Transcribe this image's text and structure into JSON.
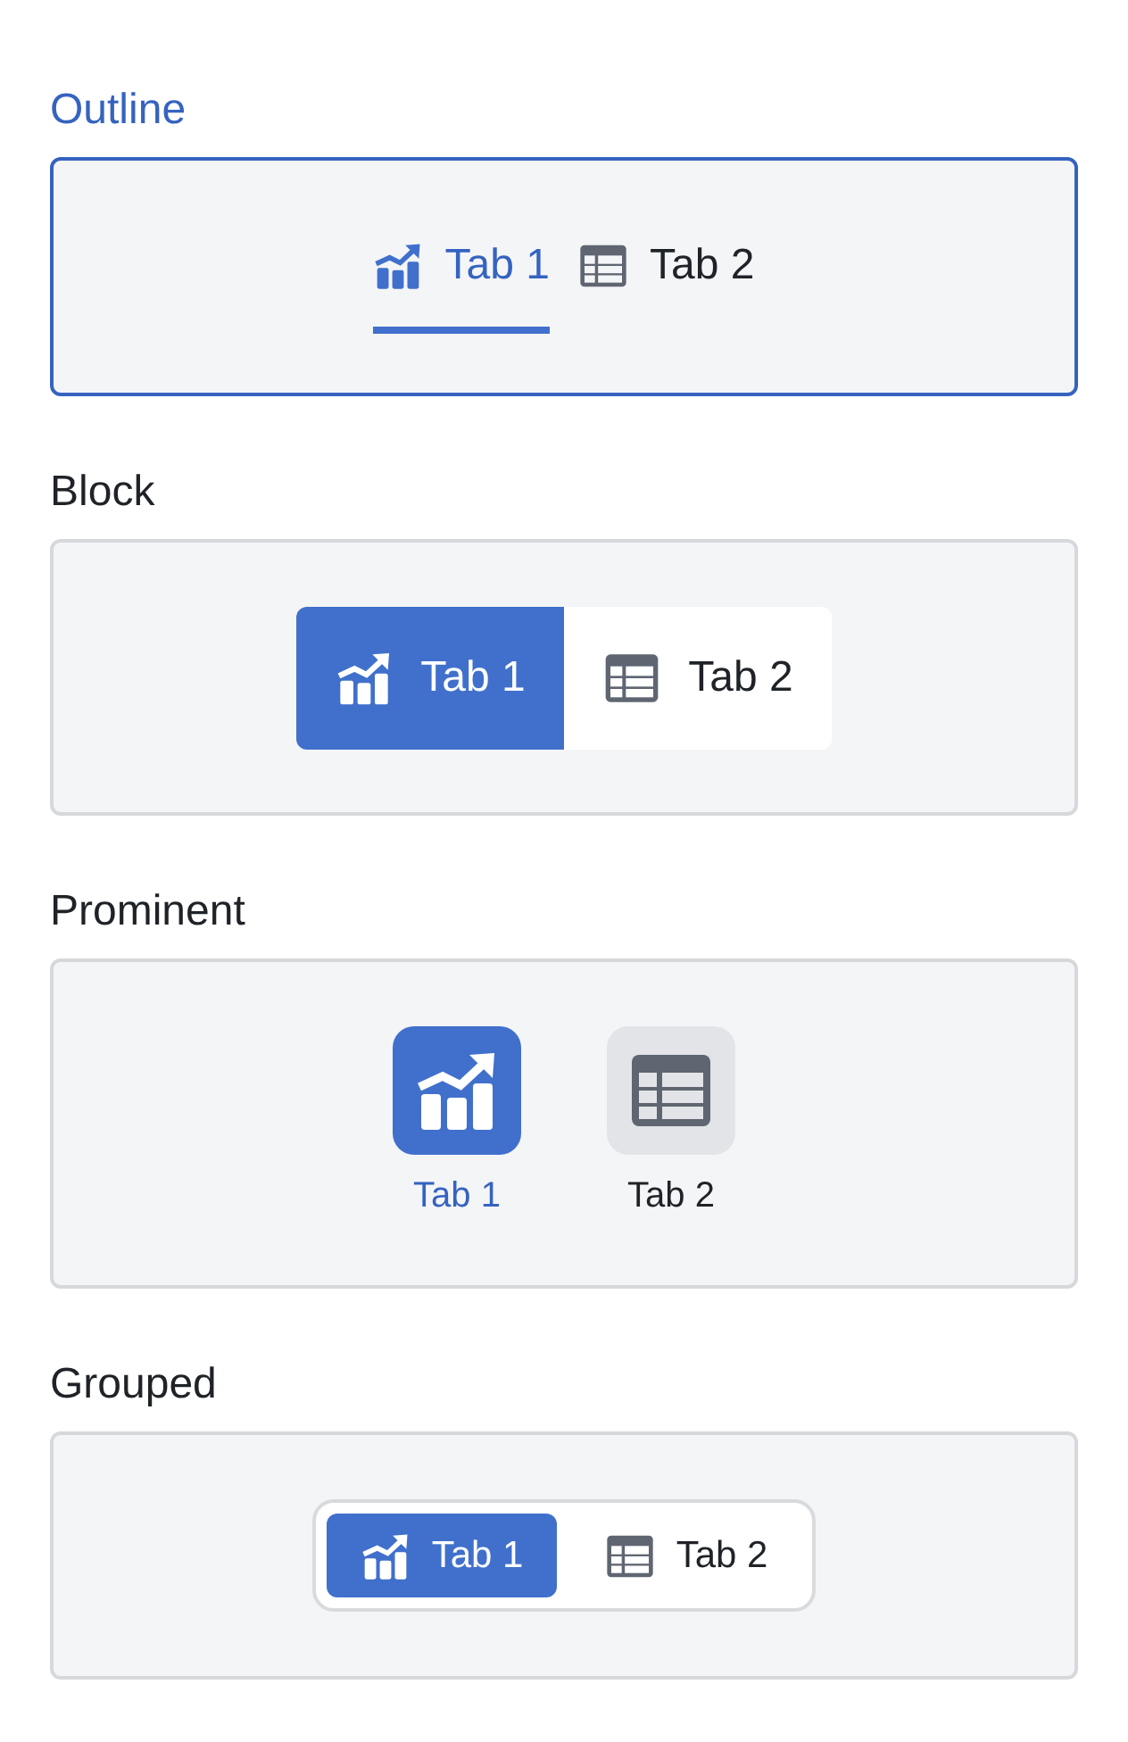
{
  "sections": [
    {
      "kind": "outline",
      "label": "Outline",
      "focused": true,
      "tabs": [
        {
          "label": "Tab 1",
          "kind": "chart",
          "selected": true
        },
        {
          "label": "Tab 2",
          "kind": "table",
          "selected": false
        }
      ]
    },
    {
      "kind": "block",
      "label": "Block",
      "focused": false,
      "tabs": [
        {
          "label": "Tab 1",
          "kind": "chart",
          "selected": true
        },
        {
          "label": "Tab 2",
          "kind": "table",
          "selected": false
        }
      ]
    },
    {
      "kind": "prominent",
      "label": "Prominent",
      "focused": false,
      "tabs": [
        {
          "label": "Tab 1",
          "kind": "chart",
          "selected": true
        },
        {
          "label": "Tab 2",
          "kind": "table",
          "selected": false
        }
      ]
    },
    {
      "kind": "grouped",
      "label": "Grouped",
      "focused": false,
      "tabs": [
        {
          "label": "Tab 1",
          "kind": "chart",
          "selected": true
        },
        {
          "label": "Tab 2",
          "kind": "table",
          "selected": false
        }
      ]
    }
  ]
}
